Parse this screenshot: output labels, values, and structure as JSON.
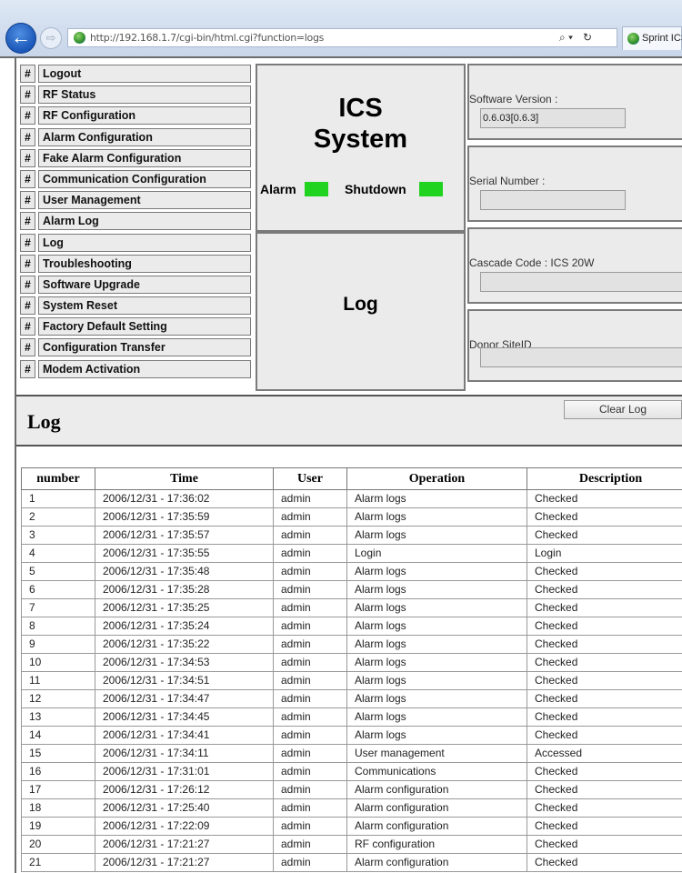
{
  "browser": {
    "url": "http://192.168.1.7/cgi-bin/html.cgi?function=logs",
    "tab_title": "Sprint ICS",
    "back_glyph": "←",
    "forward_glyph": "⇨",
    "search_glyph": "⌕ ▾",
    "refresh_glyph": "↻"
  },
  "menu": {
    "hash": "#",
    "items": [
      "Logout",
      "RF Status",
      "RF Configuration",
      "Alarm Configuration",
      "Fake Alarm Configuration",
      "Communication Configuration",
      "User Management",
      "Alarm Log",
      "Log",
      "Troubleshooting",
      "Software Upgrade",
      "System Reset",
      "Factory Default Setting",
      "Configuration Transfer",
      "Modem Activation"
    ]
  },
  "system_panel": {
    "title_line1": "ICS",
    "title_line2": "System",
    "alarm_label": "Alarm",
    "shutdown_label": "Shutdown",
    "alarm_color": "#1fd31f",
    "shutdown_color": "#1fd31f"
  },
  "page_panel": {
    "title": "Log"
  },
  "info": {
    "software_version": {
      "label": "Software Version :",
      "value": "0.6.03[0.6.3]"
    },
    "serial_number": {
      "label": "Serial Number :",
      "value": ""
    },
    "cascade_code": {
      "label": "Cascade Code : ICS 20W",
      "value": ""
    },
    "donor_site_id": {
      "label": "Donor SiteID",
      "value": ""
    }
  },
  "log_header": {
    "title": "Log",
    "clear_button": "Clear Log"
  },
  "log_table": {
    "headers": [
      "number",
      "Time",
      "User",
      "Operation",
      "Description"
    ],
    "rows": [
      [
        "1",
        "2006/12/31 - 17:36:02",
        "admin",
        "Alarm logs",
        "Checked"
      ],
      [
        "2",
        "2006/12/31 - 17:35:59",
        "admin",
        "Alarm logs",
        "Checked"
      ],
      [
        "3",
        "2006/12/31 - 17:35:57",
        "admin",
        "Alarm logs",
        "Checked"
      ],
      [
        "4",
        "2006/12/31 - 17:35:55",
        "admin",
        "Login",
        "Login"
      ],
      [
        "5",
        "2006/12/31 - 17:35:48",
        "admin",
        "Alarm logs",
        "Checked"
      ],
      [
        "6",
        "2006/12/31 - 17:35:28",
        "admin",
        "Alarm logs",
        "Checked"
      ],
      [
        "7",
        "2006/12/31 - 17:35:25",
        "admin",
        "Alarm logs",
        "Checked"
      ],
      [
        "8",
        "2006/12/31 - 17:35:24",
        "admin",
        "Alarm logs",
        "Checked"
      ],
      [
        "9",
        "2006/12/31 - 17:35:22",
        "admin",
        "Alarm logs",
        "Checked"
      ],
      [
        "10",
        "2006/12/31 - 17:34:53",
        "admin",
        "Alarm logs",
        "Checked"
      ],
      [
        "11",
        "2006/12/31 - 17:34:51",
        "admin",
        "Alarm logs",
        "Checked"
      ],
      [
        "12",
        "2006/12/31 - 17:34:47",
        "admin",
        "Alarm logs",
        "Checked"
      ],
      [
        "13",
        "2006/12/31 - 17:34:45",
        "admin",
        "Alarm logs",
        "Checked"
      ],
      [
        "14",
        "2006/12/31 - 17:34:41",
        "admin",
        "Alarm logs",
        "Checked"
      ],
      [
        "15",
        "2006/12/31 - 17:34:11",
        "admin",
        "User management",
        "Accessed"
      ],
      [
        "16",
        "2006/12/31 - 17:31:01",
        "admin",
        "Communications",
        "Checked"
      ],
      [
        "17",
        "2006/12/31 - 17:26:12",
        "admin",
        "Alarm configuration",
        "Checked"
      ],
      [
        "18",
        "2006/12/31 - 17:25:40",
        "admin",
        "Alarm configuration",
        "Checked"
      ],
      [
        "19",
        "2006/12/31 - 17:22:09",
        "admin",
        "Alarm configuration",
        "Checked"
      ],
      [
        "20",
        "2006/12/31 - 17:21:27",
        "admin",
        "RF configuration",
        "Checked"
      ],
      [
        "21",
        "2006/12/31 - 17:21:27",
        "admin",
        "Alarm configuration",
        "Checked"
      ]
    ]
  }
}
